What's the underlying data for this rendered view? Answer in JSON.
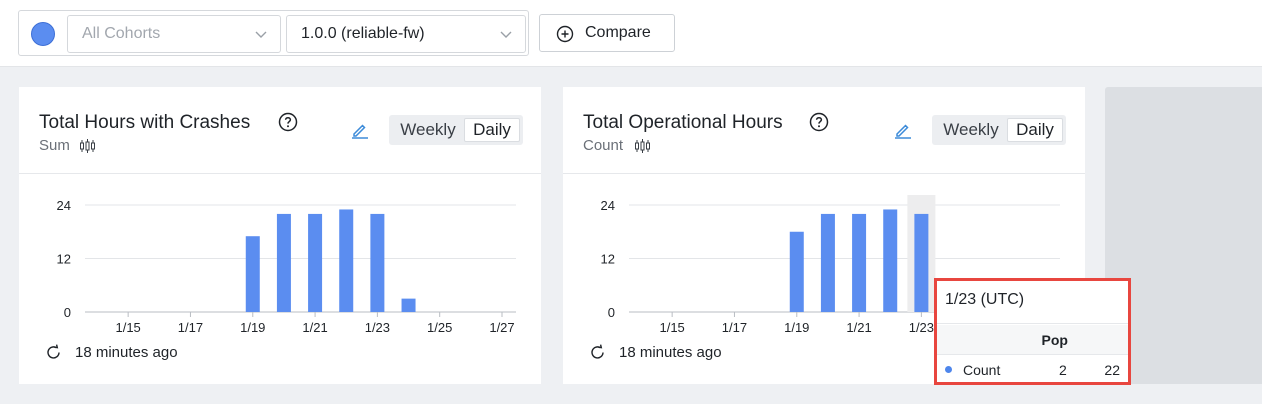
{
  "filters": {
    "cohort_placeholder": "All Cohorts",
    "version_value": "1.0.0 (reliable-fw)",
    "series_color": "#5b8df0",
    "compare_label": "Compare"
  },
  "cards": [
    {
      "title": "Total Hours with Crashes",
      "subtitle": "Sum",
      "toggle": [
        "Weekly",
        "Daily"
      ],
      "active_toggle": "Daily",
      "updated": "18 minutes ago"
    },
    {
      "title": "Total Operational Hours",
      "subtitle": "Count",
      "toggle": [
        "Weekly",
        "Daily"
      ],
      "active_toggle": "Daily",
      "updated": "18 minutes ago"
    }
  ],
  "chart_data": [
    {
      "type": "bar",
      "x_ticks": [
        "1/15",
        "1/17",
        "1/19",
        "1/21",
        "1/23",
        "1/25",
        "1/27"
      ],
      "y_ticks": [
        0,
        12,
        24
      ],
      "ylim": [
        0,
        24
      ],
      "categories": [
        "1/19",
        "1/20",
        "1/21",
        "1/22",
        "1/23",
        "1/24"
      ],
      "values": [
        17,
        22,
        22,
        23,
        22,
        3
      ],
      "color": "#5b8df0"
    },
    {
      "type": "bar",
      "x_ticks": [
        "1/15",
        "1/17",
        "1/19",
        "1/21",
        "1/23"
      ],
      "y_ticks": [
        0,
        12,
        24
      ],
      "ylim": [
        0,
        24
      ],
      "categories": [
        "1/19",
        "1/20",
        "1/21",
        "1/22",
        "1/23"
      ],
      "values": [
        18,
        22,
        22,
        23,
        22
      ],
      "color": "#5b8df0",
      "highlight_category": "1/23"
    }
  ],
  "tooltip": {
    "title": "1/23 (UTC)",
    "column_header": "Pop",
    "row_label": "Count",
    "row_n": "2",
    "row_value": "22",
    "border_color": "#e8463f"
  },
  "icons": [
    "circle-plus-icon",
    "chevron-down-icon",
    "help-circle-icon",
    "candlestick-icon",
    "pencil-icon",
    "refresh-icon"
  ]
}
